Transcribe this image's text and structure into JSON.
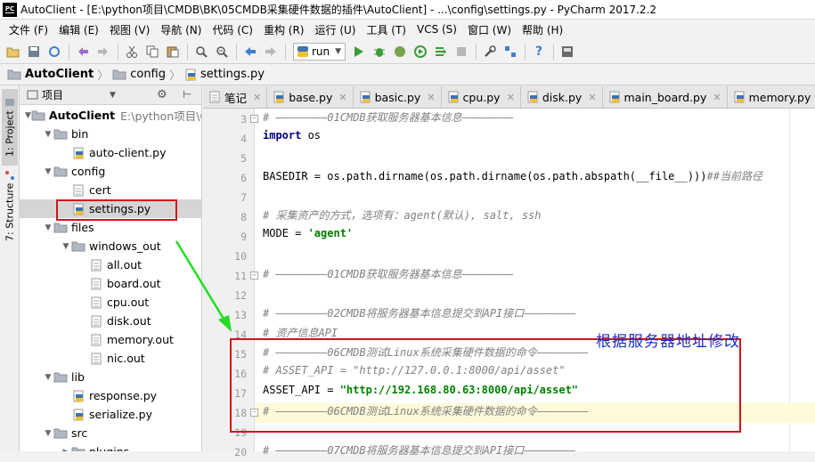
{
  "window": {
    "title": "AutoClient - [E:\\python项目\\CMDB\\BK\\05CMDB采集硬件数据的插件\\AutoClient] - ...\\config\\settings.py - PyCharm 2017.2.2",
    "logo_text": "PC"
  },
  "menu": [
    "文件 (F)",
    "编辑 (E)",
    "视图 (V)",
    "导航 (N)",
    "代码 (C)",
    "重构 (R)",
    "运行 (U)",
    "工具 (T)",
    "VCS (S)",
    "窗口 (W)",
    "帮助 (H)"
  ],
  "toolbar": {
    "run_config": "run"
  },
  "breadcrumb": [
    "AutoClient",
    "config",
    "settings.py"
  ],
  "side_tabs": {
    "project": "1: Project",
    "structure": "7: Structure"
  },
  "project_panel": {
    "header": "项目",
    "tree": [
      {
        "label": "AutoClient",
        "path": "E:\\python项目\\C",
        "type": "folder",
        "open": true,
        "depth": 0
      },
      {
        "label": "bin",
        "type": "folder",
        "open": true,
        "depth": 1
      },
      {
        "label": "auto-client.py",
        "type": "py",
        "depth": 2
      },
      {
        "label": "config",
        "type": "folder",
        "open": true,
        "depth": 1
      },
      {
        "label": "cert",
        "type": "file",
        "depth": 2
      },
      {
        "label": "settings.py",
        "type": "py",
        "depth": 2,
        "selected": true
      },
      {
        "label": "files",
        "type": "folder",
        "open": true,
        "depth": 1
      },
      {
        "label": "windows_out",
        "type": "folder",
        "open": true,
        "depth": 2
      },
      {
        "label": "all.out",
        "type": "file",
        "depth": 3
      },
      {
        "label": "board.out",
        "type": "file",
        "depth": 3
      },
      {
        "label": "cpu.out",
        "type": "file",
        "depth": 3
      },
      {
        "label": "disk.out",
        "type": "file",
        "depth": 3
      },
      {
        "label": "memory.out",
        "type": "file",
        "depth": 3
      },
      {
        "label": "nic.out",
        "type": "file",
        "depth": 3
      },
      {
        "label": "lib",
        "type": "folder",
        "open": true,
        "depth": 1
      },
      {
        "label": "response.py",
        "type": "py",
        "depth": 2
      },
      {
        "label": "serialize.py",
        "type": "py",
        "depth": 2
      },
      {
        "label": "src",
        "type": "folder",
        "open": true,
        "depth": 1
      },
      {
        "label": "plugins",
        "type": "folder",
        "open": false,
        "depth": 2
      }
    ]
  },
  "editor_tabs": [
    {
      "label": "笔记",
      "type": "txt"
    },
    {
      "label": "base.py",
      "type": "py"
    },
    {
      "label": "basic.py",
      "type": "py"
    },
    {
      "label": "cpu.py",
      "type": "py"
    },
    {
      "label": "disk.py",
      "type": "py"
    },
    {
      "label": "main_board.py",
      "type": "py"
    },
    {
      "label": "memory.py",
      "type": "py"
    }
  ],
  "code_lines": [
    {
      "num": "3",
      "text": "# ————————01CMDB获取服务器基本信息————————",
      "cls": "cmt"
    },
    {
      "num": "4",
      "parts": [
        {
          "t": "import",
          "c": "kw"
        },
        {
          "t": " os",
          "c": ""
        }
      ]
    },
    {
      "num": "5",
      "text": ""
    },
    {
      "num": "6",
      "parts": [
        {
          "t": "BASEDIR = os.path.dirname(os.path.dirname(os.path.abspath(__file__)))",
          "c": ""
        },
        {
          "t": "##当前路径",
          "c": "cmt"
        }
      ]
    },
    {
      "num": "7",
      "text": ""
    },
    {
      "num": "8",
      "text": "# 采集资产的方式，选项有：agent(默认), salt, ssh",
      "cls": "cmt"
    },
    {
      "num": "9",
      "parts": [
        {
          "t": "MODE = ",
          "c": ""
        },
        {
          "t": "'agent'",
          "c": "str"
        }
      ]
    },
    {
      "num": "10",
      "text": ""
    },
    {
      "num": "11",
      "text": "# ————————01CMDB获取服务器基本信息————————",
      "cls": "cmt"
    },
    {
      "num": "12",
      "text": ""
    },
    {
      "num": "13",
      "text": "# ————————02CMDB将服务器基本信息提交到API接口————————",
      "cls": "cmt"
    },
    {
      "num": "14",
      "text": "# 资产信息API",
      "cls": "cmt"
    },
    {
      "num": "15",
      "text": "# ————————06CMDB测试Linux系统采集硬件数据的命令————————",
      "cls": "cmt"
    },
    {
      "num": "16",
      "text": "# ASSET_API = \"http://127.0.0.1:8000/api/asset\"",
      "cls": "cmt"
    },
    {
      "num": "17",
      "parts": [
        {
          "t": "ASSET_API = ",
          "c": ""
        },
        {
          "t": "\"http://192.168.80.63:8000/api/asset\"",
          "c": "str"
        }
      ]
    },
    {
      "num": "18",
      "text": "# ————————06CMDB测试Linux系统采集硬件数据的命令————————",
      "cls": "cmt"
    },
    {
      "num": "19",
      "text": ""
    },
    {
      "num": "20",
      "text": "# ————————07CMDB将服务器基本信息提交到API接口————————",
      "cls": "cmt"
    }
  ],
  "annotation": {
    "text": "根据服务器地址修改",
    "color": "#1a2ec4"
  },
  "colors": {
    "highlight_box": "#d0141c",
    "arrow": "#22dd22",
    "caret_line": "#fcfad9",
    "keyword": "#000080",
    "string": "#008000",
    "comment": "#808080"
  }
}
